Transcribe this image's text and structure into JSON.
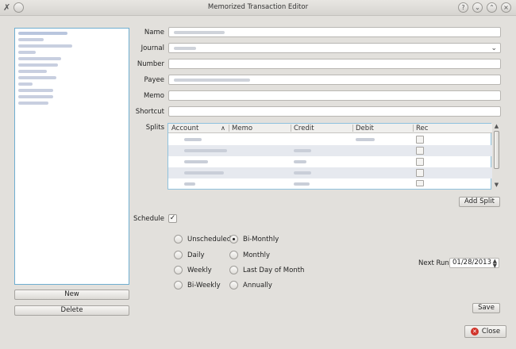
{
  "window": {
    "title": "Memorized Transaction Editor"
  },
  "list": {
    "rows": 12
  },
  "buttons": {
    "new": "New",
    "delete": "Delete",
    "add_split": "Add Split",
    "save": "Save",
    "close": "Close"
  },
  "form": {
    "name_label": "Name",
    "journal_label": "Journal",
    "number_label": "Number",
    "payee_label": "Payee",
    "memo_label": "Memo",
    "shortcut_label": "Shortcut",
    "splits_label": "Splits"
  },
  "splits": {
    "columns": [
      "Account",
      "Memo",
      "Credit",
      "Debit",
      "Rec"
    ],
    "rows": 5
  },
  "schedule": {
    "label": "Schedule",
    "enabled": true,
    "options": [
      "Unscheduled",
      "Bi-Monthly",
      "Daily",
      "Monthly",
      "Weekly",
      "Last Day of Month",
      "Bi-Weekly",
      "Annually"
    ],
    "selected": "Bi-Monthly",
    "next_run_label": "Next Run",
    "next_run_value": "01/28/2013"
  },
  "icons": {
    "app": "x-icon",
    "help": "help-icon",
    "minimize": "chevron-down-icon",
    "maximize": "chevron-up-icon",
    "close": "close-icon"
  }
}
